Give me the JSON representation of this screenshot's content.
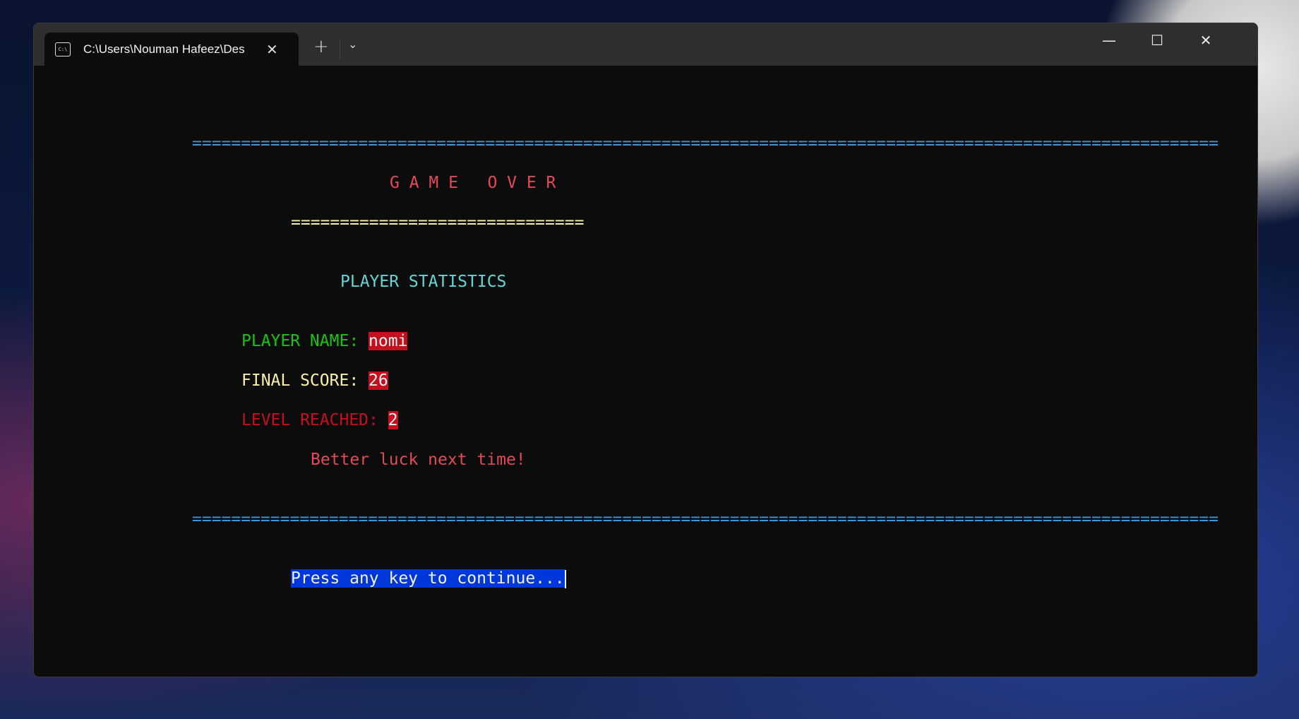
{
  "window": {
    "tab_title": "C:\\Users\\Nouman Hafeez\\Des",
    "tab_icon": "console-icon",
    "tab_icon_text": "C:\\",
    "new_tab": "+",
    "dropdown": "⌄",
    "minimize": "—",
    "maximize": "☐",
    "close": "✕"
  },
  "terminal": {
    "separator_top": "=========================================================================================================",
    "title": "G A M E   O V E R",
    "title_underline": "==============================",
    "stats_heading": "PLAYER STATISTICS",
    "player_name_label": "PLAYER NAME: ",
    "player_name_value": "nomi",
    "final_score_label": "FINAL SCORE: ",
    "final_score_value": "26",
    "level_label": "LEVEL REACHED: ",
    "level_value": "2",
    "message": "Better luck next time!",
    "separator_bottom": "=========================================================================================================",
    "prompt": "Press any key to continue..."
  },
  "colors": {
    "separator": "#3a96dd",
    "title": "#e74856",
    "highlight": "#c50f1f",
    "prompt_bg": "#0037da"
  }
}
